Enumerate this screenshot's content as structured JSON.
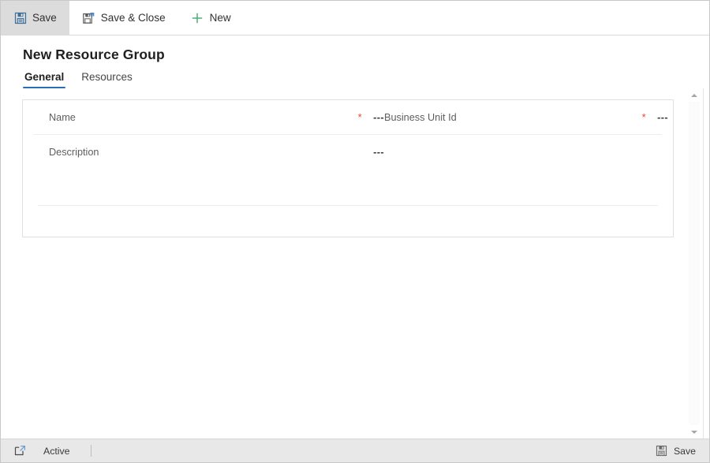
{
  "window": {
    "border_color": "#c8c8c8",
    "background": "#ffffff"
  },
  "command_bar": {
    "buttons": [
      {
        "id": "save",
        "label": "Save",
        "icon": "floppy-disk-icon",
        "active": true
      },
      {
        "id": "save-close",
        "label": "Save & Close",
        "icon": "floppy-disk-close-icon",
        "active": false
      },
      {
        "id": "new",
        "label": "New",
        "icon": "plus-icon",
        "active": false
      }
    ]
  },
  "header": {
    "title": "New Resource Group",
    "tabs": [
      {
        "id": "general",
        "label": "General",
        "selected": true
      },
      {
        "id": "resources",
        "label": "Resources",
        "selected": false
      }
    ],
    "tab_accent_color": "#2b6cb8"
  },
  "form": {
    "required_marker": "*",
    "required_marker_color": "#e8452c",
    "rows": [
      {
        "left": {
          "label": "Name",
          "value": "---",
          "required": true
        },
        "right": {
          "label": "Business Unit Id",
          "value": "---",
          "required": true
        }
      },
      {
        "left": {
          "label": "Description",
          "value": "---",
          "required": false
        },
        "right": {
          "label": "",
          "value": "",
          "required": false
        }
      }
    ]
  },
  "scrollbar": {
    "up_arrow": "chevron-up-icon",
    "down_arrow": "chevron-down-icon"
  },
  "status_bar": {
    "open_in_new_window_icon": "pop-out-icon",
    "record_state": "Active",
    "save_label": "Save",
    "save_icon": "floppy-disk-icon",
    "background": "#e8e8e8"
  }
}
